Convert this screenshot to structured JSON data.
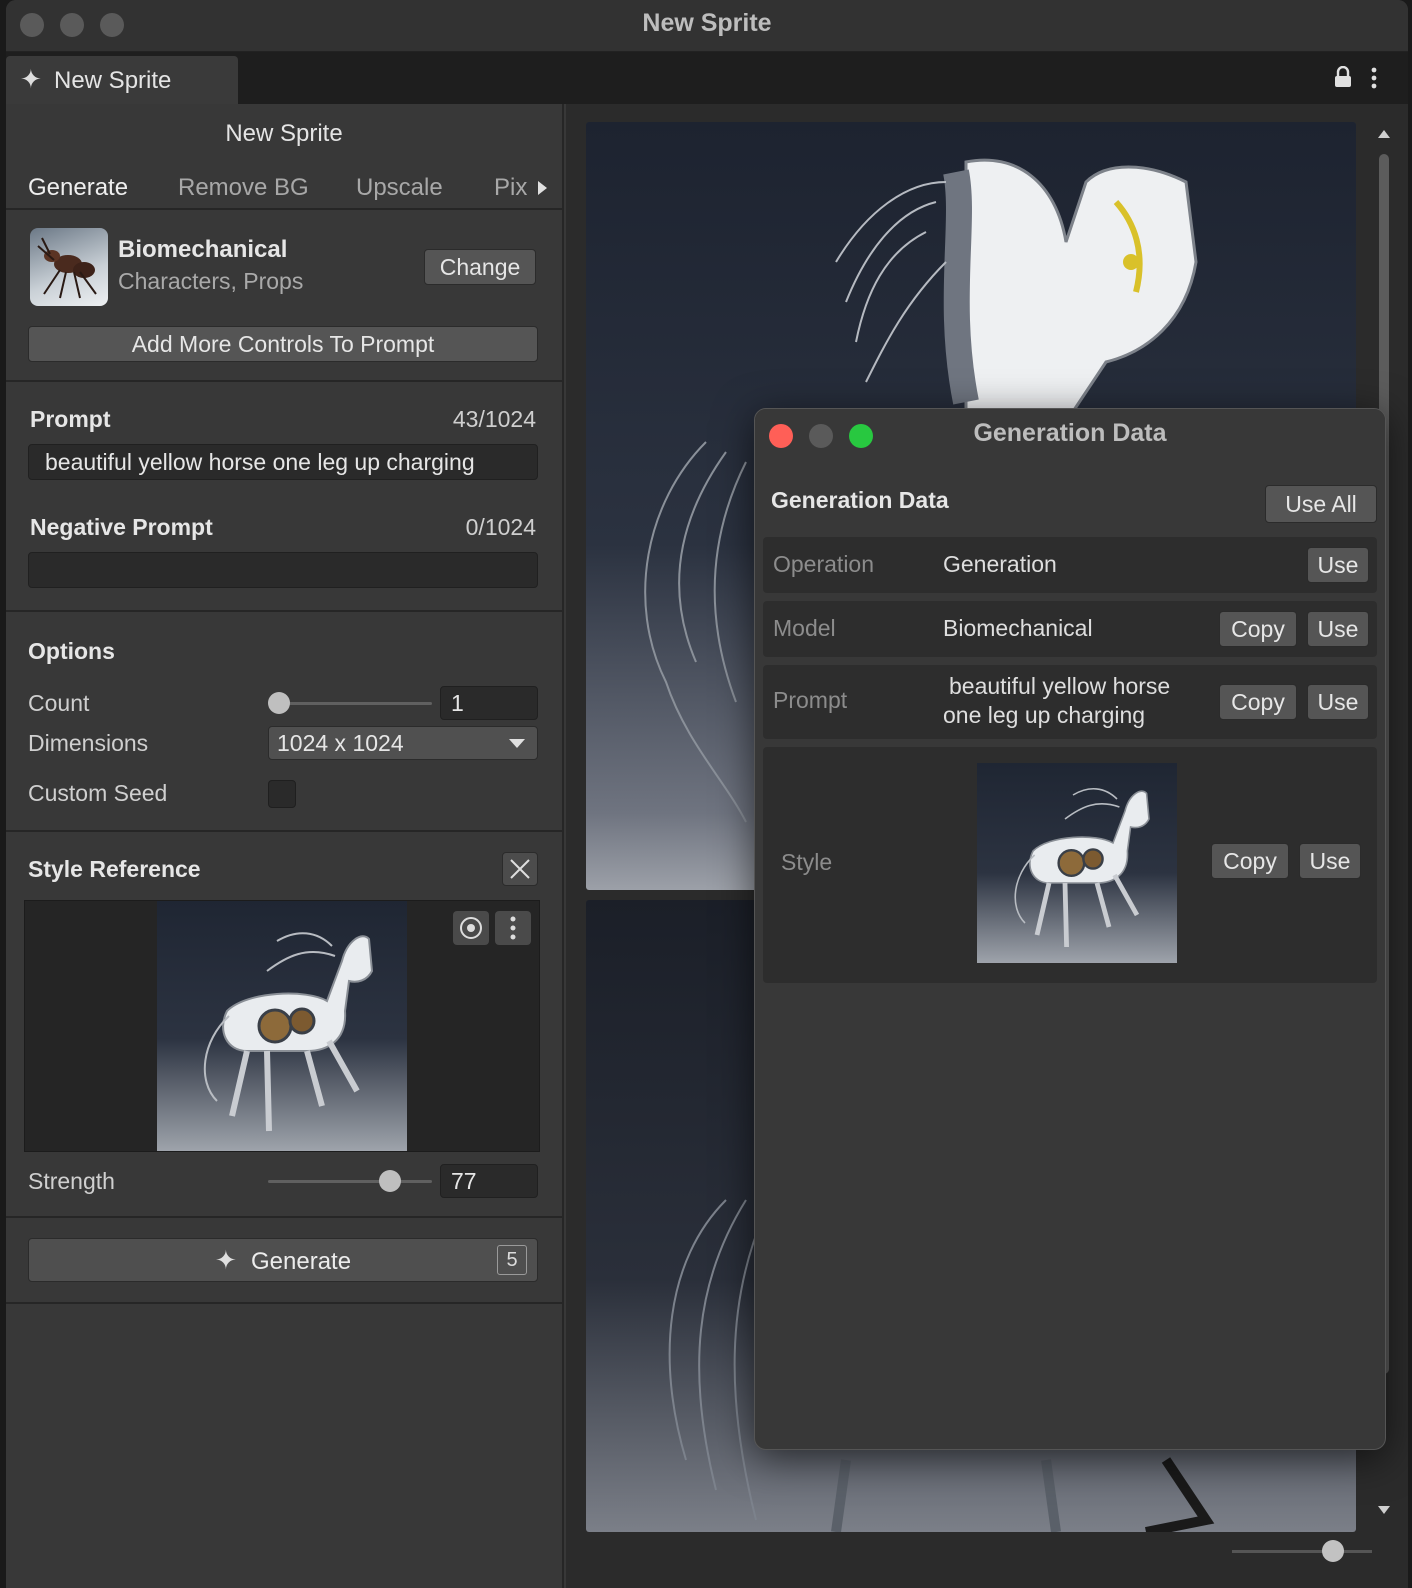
{
  "window": {
    "title": "New Sprite"
  },
  "tab": {
    "label": "New Sprite",
    "icon": "sparkle-icon"
  },
  "panel": {
    "title": "New Sprite",
    "tabs": [
      "Generate",
      "Remove BG",
      "Upscale",
      "Pix"
    ],
    "model": {
      "name": "Biomechanical",
      "tags": "Characters, Props",
      "change_label": "Change"
    },
    "add_controls_label": "Add More Controls To Prompt",
    "prompt": {
      "label": "Prompt",
      "count": "43/1024",
      "value": "beautiful yellow horse one leg up charging"
    },
    "negative_prompt": {
      "label": "Negative Prompt",
      "count": "0/1024",
      "value": ""
    },
    "options": {
      "heading": "Options",
      "count_label": "Count",
      "count_value": "1",
      "dimensions_label": "Dimensions",
      "dimensions_value": "1024 x 1024",
      "custom_seed_label": "Custom Seed",
      "custom_seed_checked": false
    },
    "style_reference": {
      "heading": "Style Reference",
      "strength_label": "Strength",
      "strength_value": "77"
    },
    "generate": {
      "label": "Generate",
      "badge": "5"
    }
  },
  "generation_data": {
    "window_title": "Generation Data",
    "heading": "Generation Data",
    "use_all_label": "Use All",
    "copy_label": "Copy",
    "use_label": "Use",
    "rows": {
      "operation": {
        "key": "Operation",
        "value": "Generation"
      },
      "model": {
        "key": "Model",
        "value": "Biomechanical"
      },
      "prompt": {
        "key": "Prompt",
        "value_line1": "beautiful yellow horse",
        "value_line2": "one leg up charging"
      },
      "style": {
        "key": "Style"
      }
    }
  },
  "colors": {
    "close": "#ff5f57",
    "minimize": "#5a5a5a",
    "zoom": "#28c840",
    "panel_bg": "#383838"
  }
}
